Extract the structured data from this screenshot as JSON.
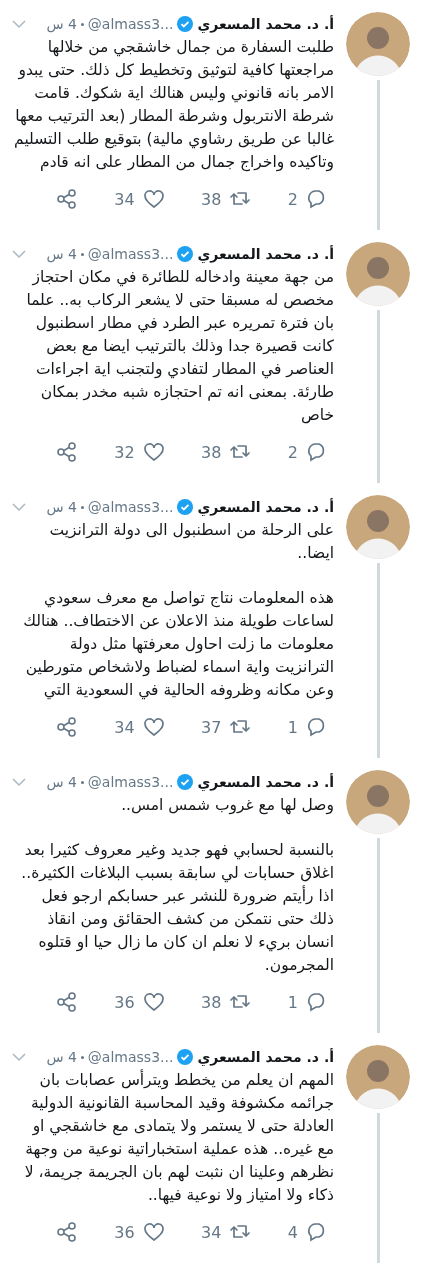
{
  "tweets": [
    {
      "author": "أ. د. محمد المسعري",
      "handle": "@almass3...",
      "time": "4 س",
      "paragraphs": [
        "طلبت السفارة من جمال  خاشقجي من خلالها مراجعتها كافية لتوثيق  وتخطيط كل ذلك.  حتى يبدو الامر  بانه قانوني وليس هنالك اية شكوك. قامت  شرطة الانتربول  وشرطة المطار (بعد الترتيب معها غالبا عن طريق رشاوي  مالية) بتوقيع طلب  التسليم وتاكيده   واخراج جمال من المطار على انه قادم"
      ],
      "replies": "2",
      "retweets": "38",
      "likes": "34"
    },
    {
      "author": "أ. د. محمد المسعري",
      "handle": "@almass3...",
      "time": "4 س",
      "paragraphs": [
        "من جهة معينة وادخاله  للطائرة في  مكان  احتجاز مخصص له مسبقا حتى لا  يشعر  الركاب به.. علما بان  فترة تمريره  عبر  الطرد في مطار اسطنبول كانت  قصيرة جدا وذلك بالترتيب ايضا  مع بعض العناصر  في المطار لتفادي  ولتجنب  اية اجراءات طارئة. بمعنى انه تم   احتجازه شبه  مخدر بمكان خاص"
      ],
      "replies": "2",
      "retweets": "38",
      "likes": "32"
    },
    {
      "author": "أ. د. محمد المسعري",
      "handle": "@almass3...",
      "time": "4 س",
      "paragraphs": [
        "على الرحلة  من اسطنبول الى دولة الترانزيت ايضا..",
        "هذه   المعلومات  نتاج تواصل مع معرف سعودي لساعات  طويلة منذ الاعلان عن   الاختطاف.. هنالك  معلومات ما زلت احاول معرفتها مثل  دولة الترانزيت   واية  اسماء لضباط  ولاشخاص متورطين وعن مكانه وظروفه  الحالية  في السعودية التي"
      ],
      "replies": "1",
      "retweets": "37",
      "likes": "34"
    },
    {
      "author": "أ. د. محمد المسعري",
      "handle": "@almass3...",
      "time": "4 س",
      "paragraphs": [
        "وصل لها مع  غروب شمس امس..",
        "بالنسبة لحسابي فهو  جديد وغير  معروف  كثيرا بعد اغلاق حسابات لي سابقة بسبب   البلاغات الكثيرة.. اذا رأيتم   ضرورة للنشر عبر حسابكم ارجو فعل ذلك  حتى  نتمكن  من  كشف الحقائق ومن انقاذ  انسان بريء لا نعلم ان كان ما زال  حيا  او قتلوه  المجرمون."
      ],
      "replies": "1",
      "retweets": "38",
      "likes": "36"
    },
    {
      "author": "أ. د. محمد المسعري",
      "handle": "@almass3...",
      "time": "4 س",
      "paragraphs": [
        "المهم  ان يعلم  من  يخطط  ويترأس عصابات بان جرائمه مكشوفة  وقيد   المحاسبة  القانونية الدولية العادلة حتى لا يستمر  ولا   يتمادى مع   خاشقجي او مع  غيره.. هذه عملية  استخباراتية نوعية من  وجهة نظرهم  وعلينا ان نثبت لهم   بان الجريمة جريمة،  لا ذكاء ولا امتياز  ولا    نوعية فيها.."
      ],
      "replies": "4",
      "retweets": "34",
      "likes": "36"
    }
  ]
}
